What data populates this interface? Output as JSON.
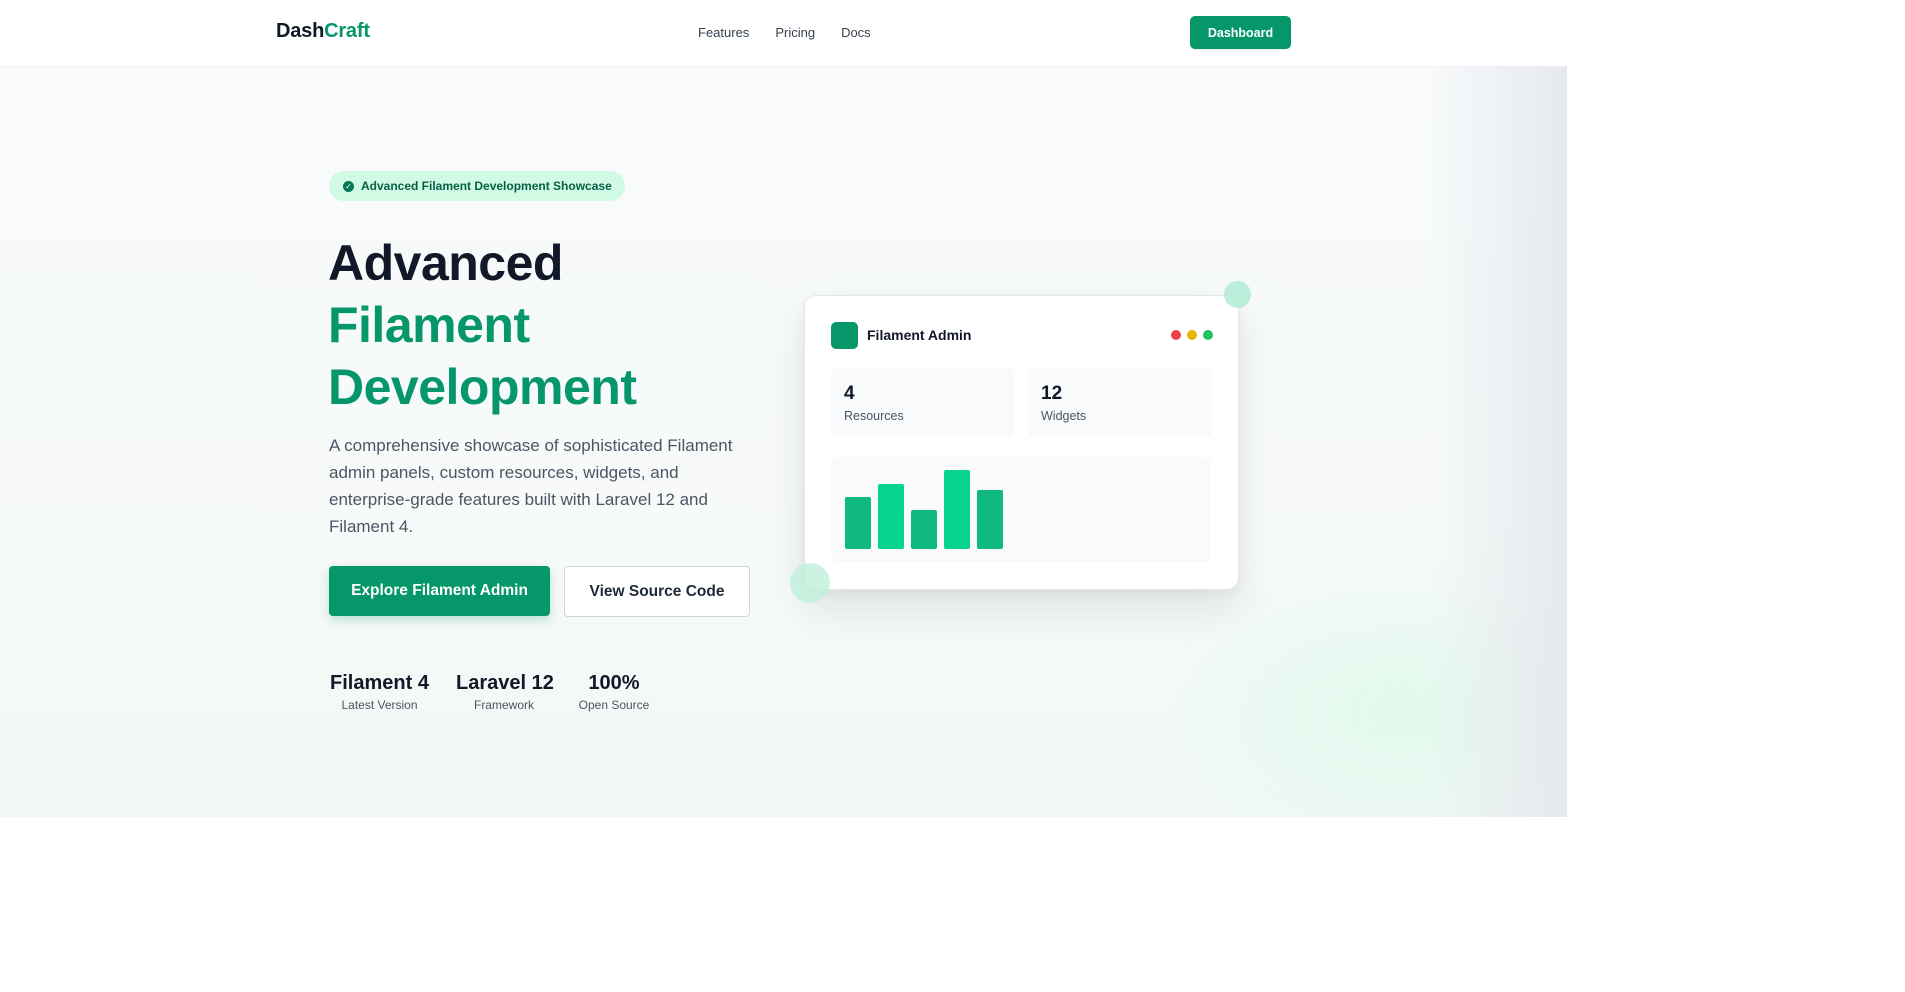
{
  "header": {
    "logo_part1": "Dash",
    "logo_part2": "Craft",
    "nav": [
      "Features",
      "Pricing",
      "Docs"
    ],
    "dashboard_label": "Dashboard"
  },
  "hero": {
    "badge": "Advanced Filament Development Showcase",
    "title_line1": "Advanced",
    "title_line2": "Filament",
    "title_line3": "Development",
    "description": "A comprehensive showcase of sophisticated Filament admin panels, custom resources, widgets, and enterprise-grade features built with Laravel 12 and Filament 4.",
    "primary_button": "Explore Filament Admin",
    "secondary_button": "View Source Code",
    "stats": [
      {
        "value": "Filament 4",
        "label": "Latest Version"
      },
      {
        "value": "Laravel 12",
        "label": "Framework"
      },
      {
        "value": "100%",
        "label": "Open Source"
      }
    ]
  },
  "mockup": {
    "title": "Filament Admin",
    "window_dot_colors": [
      "#ef4444",
      "#eab308",
      "#22c55e"
    ],
    "metrics": [
      {
        "value": "4",
        "label": "Resources"
      },
      {
        "value": "12",
        "label": "Widgets"
      }
    ],
    "bar_chart": {
      "type": "bar",
      "values": [
        52,
        65,
        39,
        79,
        59
      ],
      "colors": [
        "#10b981",
        "#06d48c",
        "#10b981",
        "#06d48c",
        "#10b981"
      ]
    }
  },
  "colors": {
    "brand": "#059669",
    "badge_bg": "#d1fae5",
    "heading": "#111827"
  }
}
